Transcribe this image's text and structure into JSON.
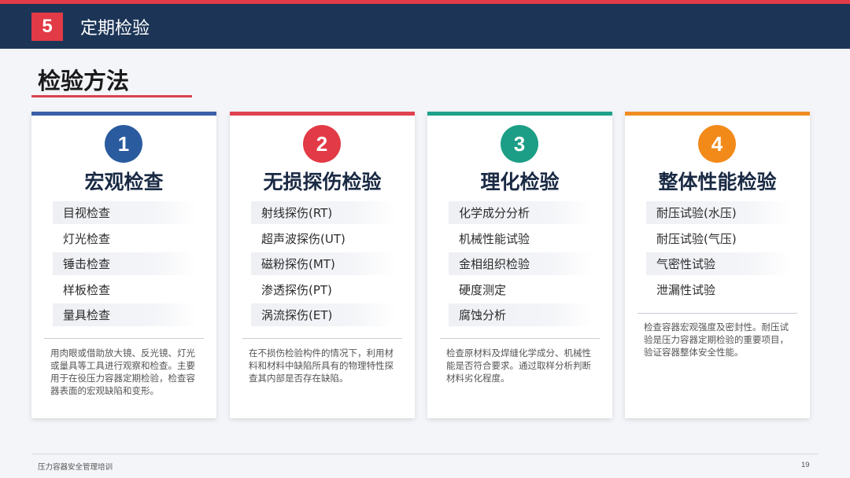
{
  "header": {
    "section_number": "5",
    "title": "定期检验"
  },
  "page_title": "检验方法",
  "cards": [
    {
      "number": "1",
      "accent": "#3a5fa8",
      "circle_color": "#2a5b9e",
      "title": "宏观检查",
      "items": [
        "目视检查",
        "灯光检查",
        "锤击检查",
        "样板检查",
        "量具检查"
      ],
      "description": "用肉眼或借助放大镜、反光镜、灯光或量具等工具进行观察和检查。主要用于在役压力容器定期检验，检查容器表面的宏观缺陷和变形。"
    },
    {
      "number": "2",
      "accent": "#e0424f",
      "circle_color": "#e23a46",
      "title": "无损探伤检验",
      "items": [
        "射线探伤(RT)",
        "超声波探伤(UT)",
        "磁粉探伤(MT)",
        "渗透探伤(PT)",
        "涡流探伤(ET)"
      ],
      "description": "在不损伤检验构件的情况下，利用材料和材料中缺陷所具有的物理特性探查其内部是否存在缺陷。"
    },
    {
      "number": "3",
      "accent": "#1fa08a",
      "circle_color": "#1c9e86",
      "title": "理化检验",
      "items": [
        "化学成分分析",
        "机械性能试验",
        "金相组织检验",
        "硬度测定",
        "腐蚀分析"
      ],
      "description": "检查原材料及焊缝化学成分、机械性能是否符合要求。通过取样分析判断材料劣化程度。"
    },
    {
      "number": "4",
      "accent": "#f08c24",
      "circle_color": "#f28a1a",
      "title": "整体性能检验",
      "items": [
        "耐压试验(水压)",
        "耐压试验(气压)",
        "气密性试验",
        "泄漏性试验"
      ],
      "description": "检查容器宏观强度及密封性。耐压试验是压力容器定期检验的重要项目，验证容器整体安全性能。"
    }
  ],
  "footer": {
    "text": "压力容器安全管理培训",
    "page_number": "19"
  }
}
